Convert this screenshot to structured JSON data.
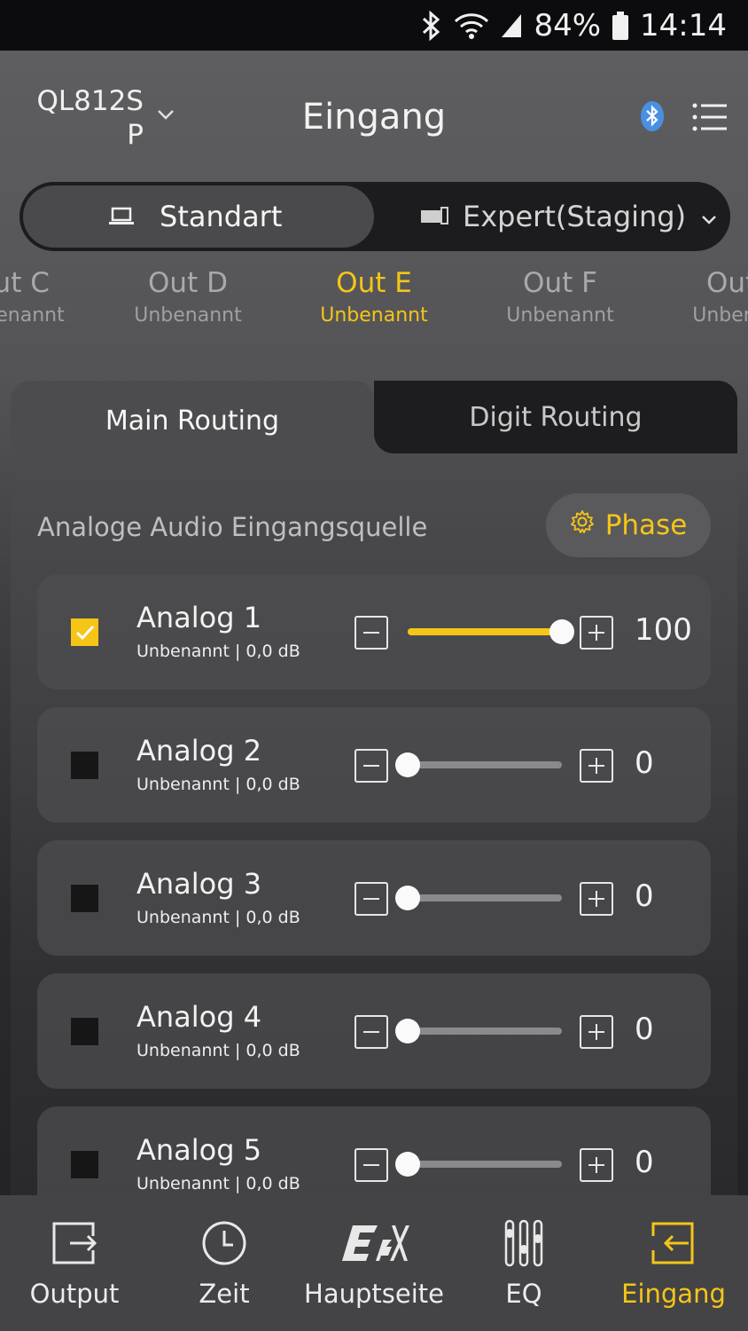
{
  "status_bar": {
    "battery": "84%",
    "time": "14:14",
    "icons": [
      "bluetooth-icon",
      "wifi-icon",
      "signal-icon",
      "battery-icon"
    ]
  },
  "header": {
    "device_line1": "QL812S",
    "device_line2": "P",
    "title": "Eingang"
  },
  "mode": {
    "standard": "Standart",
    "expert": "Expert(Staging)"
  },
  "outputs": [
    {
      "name": "Out C",
      "sub": "Unbenannt"
    },
    {
      "name": "Out D",
      "sub": "Unbenannt"
    },
    {
      "name": "Out E",
      "sub": "Unbenannt",
      "active": true
    },
    {
      "name": "Out F",
      "sub": "Unbenannt"
    },
    {
      "name": "Out G",
      "sub": "Unbenannt"
    }
  ],
  "tabs": {
    "main": "Main Routing",
    "digit": "Digit Routing"
  },
  "section": {
    "label": "Analoge Audio Eingangsquelle",
    "phase": "Phase"
  },
  "sources": [
    {
      "name": "Analog 1",
      "sub": "Unbenannt  |  0,0 dB",
      "checked": true,
      "level": 100,
      "value": "100"
    },
    {
      "name": "Analog 2",
      "sub": "Unbenannt  |  0,0 dB",
      "checked": false,
      "level": 0,
      "value": "0"
    },
    {
      "name": "Analog 3",
      "sub": "Unbenannt  |  0,0 dB",
      "checked": false,
      "level": 0,
      "value": "0"
    },
    {
      "name": "Analog 4",
      "sub": "Unbenannt  |  0,0 dB",
      "checked": false,
      "level": 0,
      "value": "0"
    },
    {
      "name": "Analog 5",
      "sub": "Unbenannt  |  0,0 dB",
      "checked": false,
      "level": 0,
      "value": "0"
    }
  ],
  "nav": [
    {
      "label": "Output",
      "icon": "output-icon"
    },
    {
      "label": "Zeit",
      "icon": "clock-icon"
    },
    {
      "label": "Hauptseite",
      "icon": "esx-logo-icon"
    },
    {
      "label": "EQ",
      "icon": "equalizer-icon"
    },
    {
      "label": "Eingang",
      "icon": "input-icon",
      "active": true
    }
  ],
  "colors": {
    "accent": "#f5c518",
    "bluetooth": "#4a90e2"
  }
}
